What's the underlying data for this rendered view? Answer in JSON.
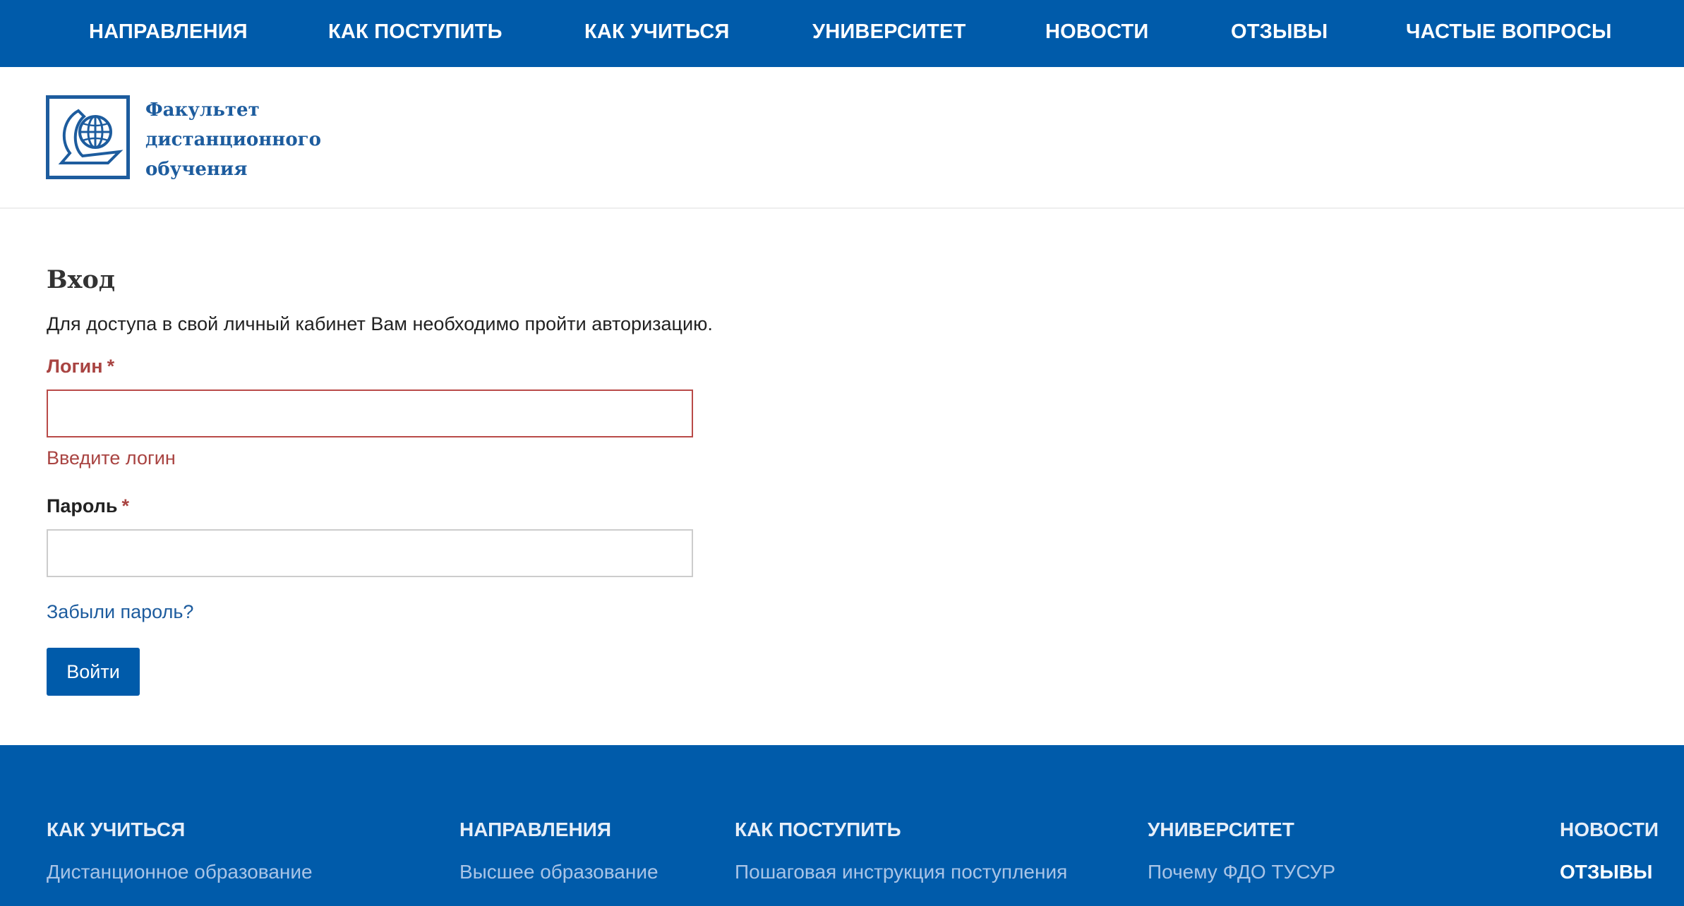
{
  "topnav": {
    "items": [
      {
        "label": "НАПРАВЛЕНИЯ"
      },
      {
        "label": "КАК ПОСТУПИТЬ"
      },
      {
        "label": "КАК УЧИТЬСЯ"
      },
      {
        "label": "УНИВЕРСИТЕТ"
      },
      {
        "label": "НОВОСТИ"
      },
      {
        "label": "ОТЗЫВЫ"
      },
      {
        "label": "ЧАСТЫЕ ВОПРОСЫ"
      }
    ]
  },
  "header": {
    "logo_icon": "globe-book-logo-icon",
    "logo_lines": [
      "Факультет",
      "дистанционного",
      "обучения"
    ]
  },
  "form": {
    "title": "Вход",
    "intro": "Для доступа в свой личный кабинет Вам необходимо пройти авторизацию.",
    "login_label": "Логин",
    "login_required": "*",
    "login_value": "",
    "login_error": "Введите логин",
    "password_label": "Пароль",
    "password_required": "*",
    "password_value": "",
    "forgot_link": "Забыли пароль?",
    "submit_label": "Войти"
  },
  "footer": {
    "columns": [
      {
        "title": "КАК УЧИТЬСЯ",
        "link": "Дистанционное образование"
      },
      {
        "title": "НАПРАВЛЕНИЯ",
        "link": "Высшее образование"
      },
      {
        "title": "КАК ПОСТУПИТЬ",
        "link": "Пошаговая инструкция поступления"
      },
      {
        "title": "УНИВЕРСИТЕТ",
        "link": "Почему ФДО ТУСУР"
      }
    ],
    "right_links": [
      "НОВОСТИ",
      "ОТЗЫВЫ"
    ]
  },
  "colors": {
    "brand_blue": "#005baa",
    "error_red": "#a94442",
    "link_blue": "#1d5c9e"
  }
}
